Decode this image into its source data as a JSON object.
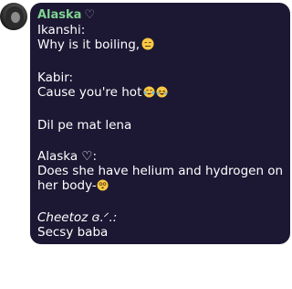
{
  "header": {
    "sender_name": "Alaska",
    "sender_heart": "♡"
  },
  "messages": [
    {
      "author": "Ikanshi:",
      "text": "Why is it boiling,",
      "emoji": "expressionless-face-icon"
    },
    {
      "author": "Kabir:",
      "text": "Cause you're hot",
      "emoji": "crying-laughing-faces-icon"
    },
    {
      "text": "Dil pe mat lena"
    },
    {
      "author": "Alaska ♡:",
      "text_line1": "Does she have helium and hydrogen on",
      "text_line2": "her body-",
      "emoji": "dizzy-face-icon"
    },
    {
      "author": "Cheetoz ɞ.ᐟ.:",
      "text": "Secsy baba"
    }
  ],
  "colors": {
    "bubble_bg": "#1c1733",
    "sender_name": "#7fd491",
    "text": "#ffffff",
    "emoji_yellow": "#f7c843"
  }
}
